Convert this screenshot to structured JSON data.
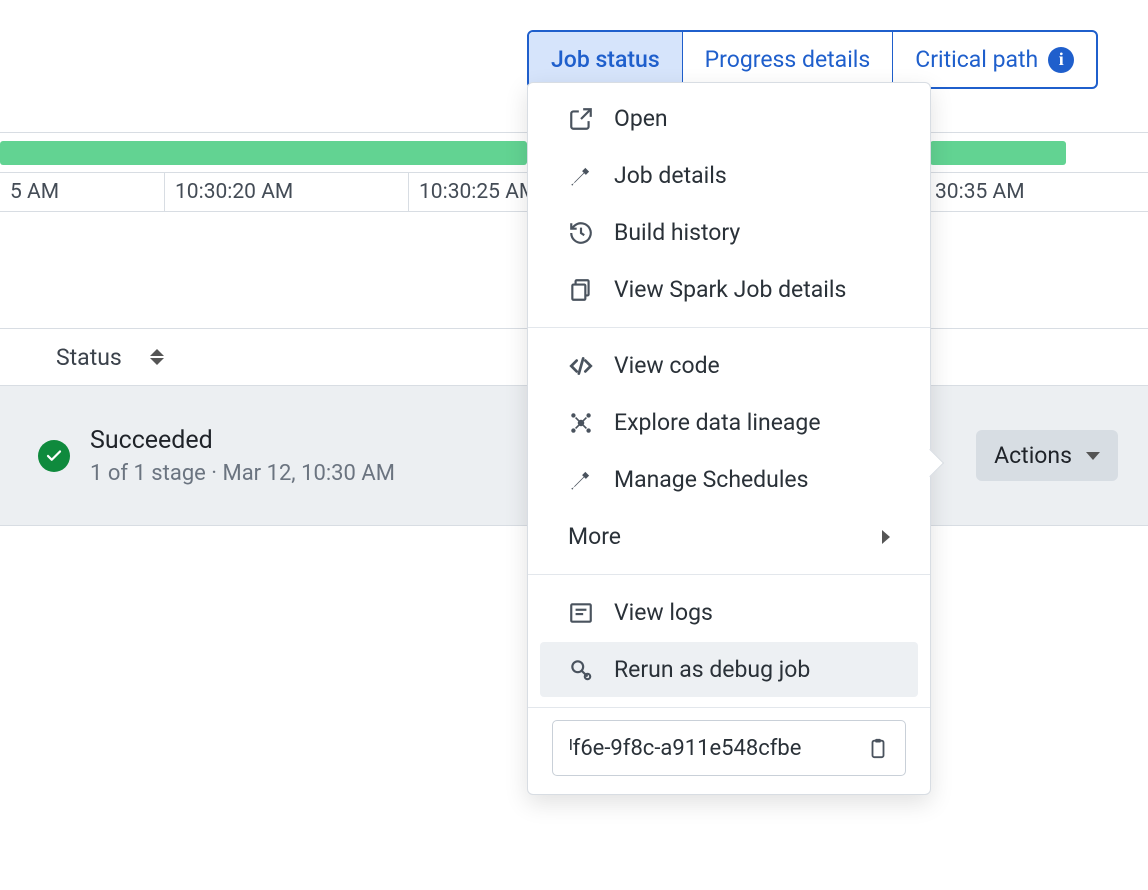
{
  "tabs": {
    "job_status": "Job status",
    "progress_details": "Progress details",
    "critical_path": "Critical path"
  },
  "timeline": {
    "ticks": [
      "5 AM",
      "10:30:20 AM",
      "10:30:25 AM",
      "30:35 AM"
    ]
  },
  "status_header": {
    "label": "Status"
  },
  "status_row": {
    "title": "Succeeded",
    "sub": "1 of 1 stage · Mar 12, 10:30 AM"
  },
  "actions": {
    "label": "Actions"
  },
  "menu": {
    "open": "Open",
    "job_details": "Job details",
    "build_history": "Build history",
    "view_spark": "View Spark Job details",
    "view_code": "View code",
    "explore_lineage": "Explore data lineage",
    "manage_schedules": "Manage Schedules",
    "more": "More",
    "view_logs": "View logs",
    "rerun_debug": "Rerun as debug job",
    "id_text": "ᴵf6e-9f8c-a911e548cfbe"
  }
}
